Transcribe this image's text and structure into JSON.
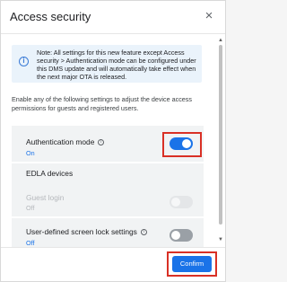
{
  "dialog": {
    "title": "Access security",
    "close_icon": "×"
  },
  "note": {
    "icon": "info-icon",
    "text": "Note: All settings for this new feature except Access security > Authentication mode can be configured under this DMS update and will automatically take effect when the next major OTA is released."
  },
  "description": "Enable any of the following settings to adjust the device access permissions for guests and registered users.",
  "settings": {
    "authentication_mode": {
      "label": "Authentication mode",
      "value": "On",
      "enabled": true
    },
    "edla_section_title": "EDLA devices",
    "guest_login": {
      "label": "Guest login",
      "value": "Off",
      "enabled": false
    },
    "screen_lock": {
      "label": "User-defined screen lock settings",
      "value": "Off",
      "enabled": false
    }
  },
  "footer": {
    "confirm_label": "Confirm"
  },
  "colors": {
    "accent": "#1a73e8",
    "highlight": "#d93025",
    "note_bg": "#eaf3fb"
  }
}
